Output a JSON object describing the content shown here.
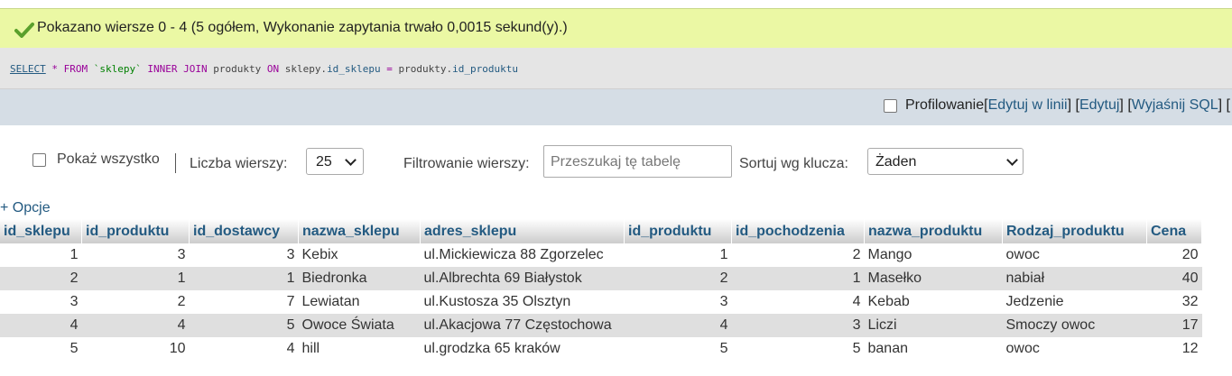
{
  "message": "Pokazano wiersze 0 - 4 (5 ogółem, Wykonanie zapytania trwało 0,0015 sekund(y).)",
  "sql": {
    "select": "SELECT",
    "star": " * ",
    "from": "FROM",
    "table": " `sklepy` ",
    "inner_join": "INNER JOIN",
    "joined": " produkty ",
    "on": "ON",
    "left_table": " sklepy.",
    "left_col": "id_sklepu",
    "eq": " = ",
    "right_table": "produkty.",
    "right_col": "id_produktu"
  },
  "toolbar": {
    "profiling": "Profilowanie",
    "open1": " [",
    "edit_inline": "Edytuj w linii",
    "close_open2": "] [ ",
    "edit": "Edytuj",
    "close_open3": " ] [ ",
    "explain": "Wyjaśnij SQL",
    "tail": " ] ["
  },
  "filters": {
    "show_all": "Pokaż wszystko",
    "rows_label": "Liczba wierszy:",
    "rows_value": "25",
    "filter_label": "Filtrowanie wierszy:",
    "filter_placeholder": "Przeszukaj tę tabelę",
    "sort_label": "Sortuj wg klucza:",
    "sort_value": "Żaden"
  },
  "options_label": "+ Opcje",
  "columns": [
    "id_sklepu",
    "id_produktu",
    "id_dostawcy",
    "nazwa_sklepu",
    "adres_sklepu",
    "id_produktu",
    "id_pochodzenia",
    "nazwa_produktu",
    "Rodzaj_produktu",
    "Cena"
  ],
  "rows": [
    [
      "1",
      "3",
      "3",
      "Kebix",
      "ul.Mickiewicza 88 Zgorzelec",
      "1",
      "2",
      "Mango",
      "owoc",
      "20"
    ],
    [
      "2",
      "1",
      "1",
      "Biedronka",
      "ul.Albrechta 69 Białystok",
      "2",
      "1",
      "Masełko",
      "nabiał",
      "40"
    ],
    [
      "3",
      "2",
      "7",
      "Lewiatan",
      "ul.Kustosza 35 Olsztyn",
      "3",
      "4",
      "Kebab",
      "Jedzenie",
      "32"
    ],
    [
      "4",
      "4",
      "5",
      "Owoce Świata",
      "ul.Akacjowa 77 Częstochowa",
      "4",
      "3",
      "Liczi",
      "Smoczy owoc",
      "17"
    ],
    [
      "5",
      "10",
      "4",
      "hill",
      "ul.grodzka 65 kraków",
      "5",
      "5",
      "banan",
      "owoc",
      "12"
    ]
  ],
  "colors": {
    "accent": "#235a81",
    "success_bg": "#ebf8a4",
    "check": "#5aa02c"
  }
}
